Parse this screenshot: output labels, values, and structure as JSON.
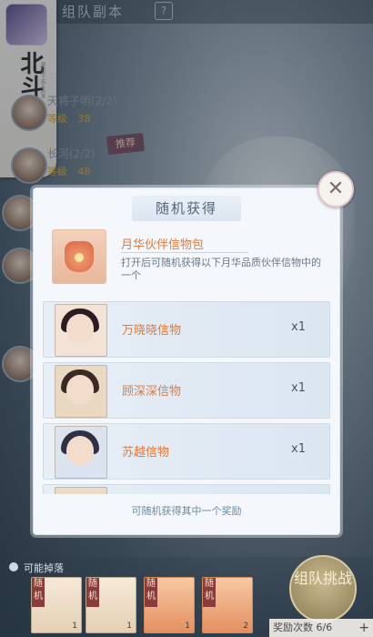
{
  "page": {
    "title": "组队副本",
    "help_icon": "question-icon"
  },
  "brand": {
    "logo_text": "北斗司",
    "app_icon": "game-app-icon",
    "sub_text": "那些沾上你头的事"
  },
  "team": {
    "rows": [
      {
        "name": "天将子明(2/2)",
        "level_label": "等级",
        "level": "38"
      },
      {
        "name": "长河(2/2)",
        "level_label": "等级",
        "level": "48"
      }
    ],
    "recommend_badge": "推荐"
  },
  "dialog": {
    "title": "随机获得",
    "close_icon": "close-icon",
    "package": {
      "name": "月华伙伴信物包",
      "description": "打开后可随机获得以下月华品质伙伴信物中的一个",
      "icon": "gift-bag-icon"
    },
    "items": [
      {
        "name": "万晓晓信物",
        "count": "x1",
        "hair_color": "#2b1d1f",
        "bg": "#f3e3d6"
      },
      {
        "name": "顾深深信物",
        "count": "x1",
        "hair_color": "#3a2a22",
        "bg": "#e9d9c2"
      },
      {
        "name": "苏越信物",
        "count": "x1",
        "hair_color": "#2c3242",
        "bg": "#dbe3ee"
      }
    ],
    "hint": "可随机获得其中一个奖励"
  },
  "bottom": {
    "drop_label": "可能掉落",
    "rewards": [
      {
        "tag": "随机",
        "count": "1",
        "style": "plain"
      },
      {
        "tag": "随机",
        "count": "1",
        "style": "plain"
      },
      {
        "tag": "随机",
        "count": "1",
        "style": "orange"
      },
      {
        "tag": "随机",
        "count": "2",
        "style": "orange"
      }
    ],
    "team_button": "组队挑战",
    "reward_times_label": "奖励次数",
    "reward_times": "6/6"
  }
}
